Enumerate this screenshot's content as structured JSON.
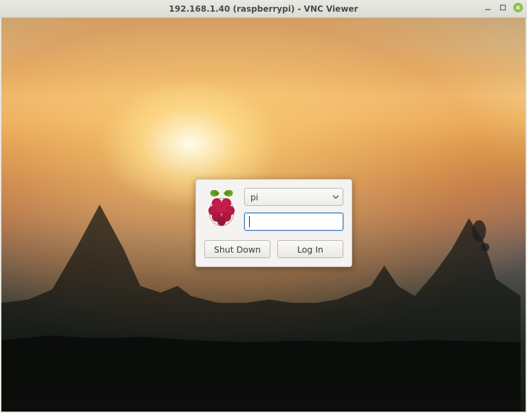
{
  "window": {
    "title": "192.168.1.40 (raspberrypi) - VNC Viewer"
  },
  "login": {
    "username": "pi",
    "password_value": "",
    "shutdown_label": "Shut Down",
    "login_label": "Log In"
  }
}
